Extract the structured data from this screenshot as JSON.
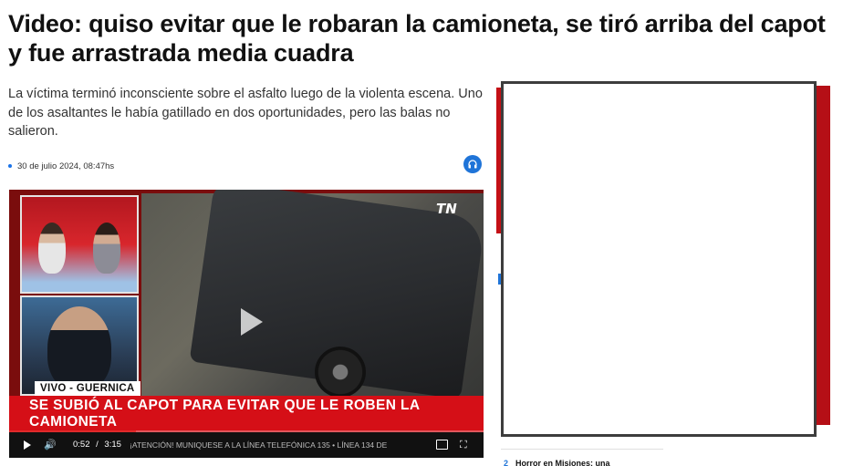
{
  "article": {
    "title": "Video: quiso evitar que le robaran la camioneta, se tiró arriba del capot y fue arrastrada media cuadra",
    "lede": "La víctima terminó inconsciente sobre el asfalto luego de la violenta escena. Uno de los asaltantes le había gatillado en dos oportunidades, pero las balas no salieron.",
    "date": "30 de julio 2024, 08:47hs",
    "audio_icon": "headphones-icon"
  },
  "video": {
    "live_tag": "VIVO - GUERNICA",
    "logo": "TN",
    "banner": "SE SUBIÓ AL CAPOT PARA EVITAR QUE LE ROBEN LA CAMIONETA",
    "ticker": "¡ATENCIÓN!  MUNIQUESE A LA LÍNEA TELEFÓNICA 135 • LÍNEA 134 DE",
    "current_time": "0:52",
    "separator": "/",
    "duration": "3:15",
    "progress_fraction": 0.267,
    "icons": [
      "play-icon",
      "volume-icon",
      "captions-icon",
      "fullscreen-icon"
    ]
  },
  "sidebar": {
    "story_number": "2",
    "story_title": "Horror en Misiones: una"
  },
  "colors": {
    "accent_red": "#d50f17",
    "accent_blue": "#1f74d8"
  }
}
